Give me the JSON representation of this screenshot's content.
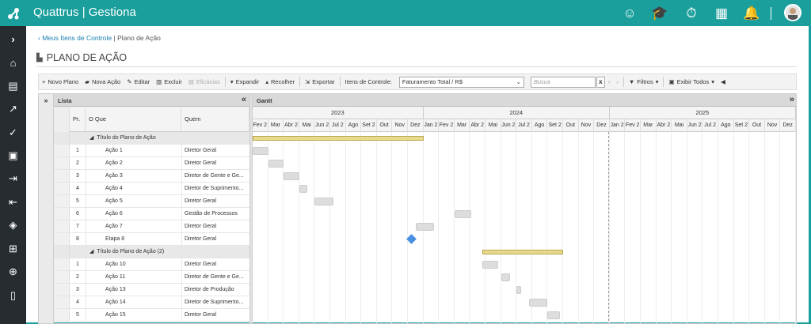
{
  "app": {
    "title": "Quattrus | Gestiona"
  },
  "breadcrumb": {
    "link": "Meus Itens de Controle",
    "sep": "|",
    "current": "Plano de Ação"
  },
  "page": {
    "title": "PLANO DE AÇÃO"
  },
  "toolbar": {
    "novo_plano": "Novo Plano",
    "nova_acao": "Nova Ação",
    "editar": "Editar",
    "excluir": "Excluir",
    "eficacias": "Eficácias",
    "expandir": "Expandir",
    "recolher": "Recolher",
    "exportar": "Exportar",
    "itens_label": "Itens de Controle:",
    "itens_value": "Faturamento Total / R$",
    "search_placeholder": "Busca",
    "filtros": "Filtros",
    "exibir": "Exibir Todos"
  },
  "grid": {
    "list_title": "Lista",
    "gantt_title": "Gantt",
    "columns": {
      "pr": "Pr.",
      "oque": "O Que",
      "quem": "Quem"
    },
    "rows": [
      {
        "pr": "",
        "oque": "Título do Plano de Ação",
        "quem": "",
        "group": true
      },
      {
        "pr": "1",
        "oque": "Ação 1",
        "quem": "Diretor Geral"
      },
      {
        "pr": "2",
        "oque": "Ação 2",
        "quem": "Diretor Geral"
      },
      {
        "pr": "3",
        "oque": "Ação 3",
        "quem": "Diretor de Gente e Ge..."
      },
      {
        "pr": "4",
        "oque": "Ação 4",
        "quem": "Diretor de Suprimento..."
      },
      {
        "pr": "5",
        "oque": "Ação 5",
        "quem": "Diretor Geral"
      },
      {
        "pr": "6",
        "oque": "Ação 6",
        "quem": "Gestão de Processos"
      },
      {
        "pr": "7",
        "oque": "Ação 7",
        "quem": "Diretor Geral"
      },
      {
        "pr": "8",
        "oque": "Etapa 8",
        "quem": "Diretor Geral"
      },
      {
        "pr": "",
        "oque": "Título do Plano de Ação (2)",
        "quem": "",
        "group": true
      },
      {
        "pr": "1",
        "oque": "Ação 10",
        "quem": "Diretor Geral"
      },
      {
        "pr": "2",
        "oque": "Ação 11",
        "quem": "Diretor de Gente e Ge..."
      },
      {
        "pr": "3",
        "oque": "Ação 13",
        "quem": "Diretor de Produção"
      },
      {
        "pr": "4",
        "oque": "Ação 14",
        "quem": "Diretor de Suprimento..."
      },
      {
        "pr": "5",
        "oque": "Ação 15",
        "quem": "Diretor Geral"
      }
    ],
    "years": [
      "2023",
      "2024",
      "2025"
    ],
    "months": [
      "Fev 2",
      "Mar",
      "Abr 2",
      "Mai",
      "Jun 2",
      "Jul 2",
      "Ago",
      "Set 2",
      "Out",
      "Nov",
      "Dez",
      "Jan 2",
      "Fev 2",
      "Mar",
      "Abr 2",
      "Mai",
      "Jun 2",
      "Jul 2",
      "Ago",
      "Set 2",
      "Out",
      "Nov",
      "Dez",
      "Jan 2",
      "Fev 2",
      "Mar",
      "Abr 2",
      "Mai",
      "Jun 2",
      "Jul 2",
      "Ago",
      "Set 2",
      "Out",
      "Nov",
      "Dez"
    ]
  },
  "colors": {
    "brand": "#1a9f9c",
    "sidebar": "#272c31",
    "summary_bar": "#e8d98c",
    "task_bar": "#dddddd",
    "milestone": "#4a90e2"
  }
}
